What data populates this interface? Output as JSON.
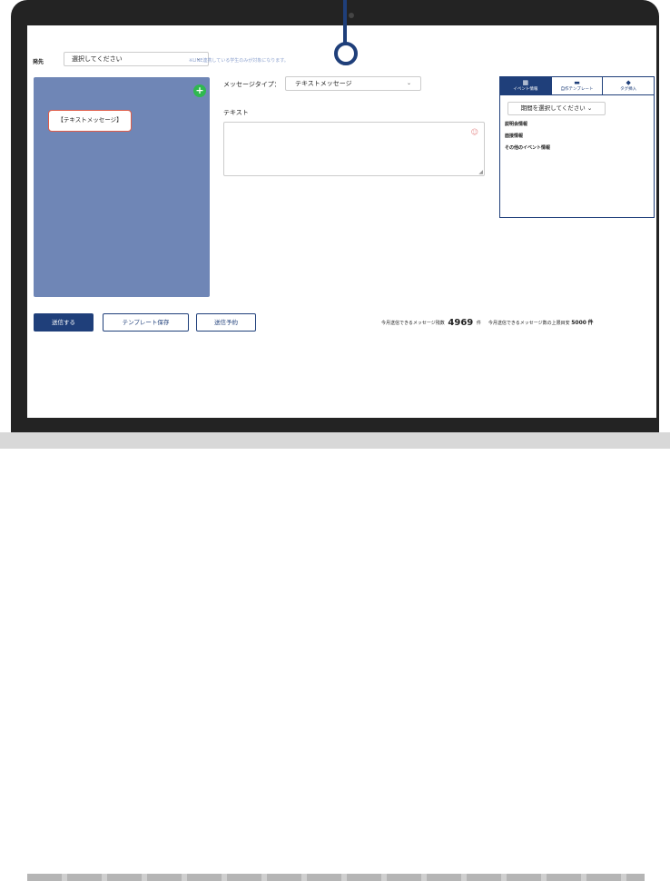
{
  "destination": {
    "label": "発先",
    "select_value": "選択してください",
    "note": "※LINE連携している学生のみが対象になります。"
  },
  "preview": {
    "message_card": "【テキストメッセージ】",
    "add_icon": "plus-icon"
  },
  "message": {
    "type_label": "メッセージタイプ：",
    "type_value": "テキストメッセージ",
    "text_label": "テキスト"
  },
  "panel": {
    "tabs": [
      {
        "label": "イベント情報",
        "icon": "calendar-icon"
      },
      {
        "label": "自作テンプレート",
        "icon": "template-icon"
      },
      {
        "label": "タグ挿入",
        "icon": "tag-icon"
      }
    ],
    "period_select": "期間を選択してください",
    "items": [
      "説明会情報",
      "面接情報",
      "その他のイベント情報"
    ]
  },
  "actions": {
    "send": "送信する",
    "save_template": "テンプレート保存",
    "schedule": "送信予約"
  },
  "stats": {
    "remaining_label": "今月送信できるメッセージ残数",
    "remaining_value": "4969",
    "remaining_unit": "件",
    "limit_label": "今月送信できるメッセージ数の上限目安",
    "limit_value": "5000",
    "limit_unit": "件"
  },
  "colors": {
    "primary": "#1f3f7a",
    "preview_bg": "#6f86b6",
    "add_green": "#2fb84f",
    "card_border": "#e05b47"
  }
}
